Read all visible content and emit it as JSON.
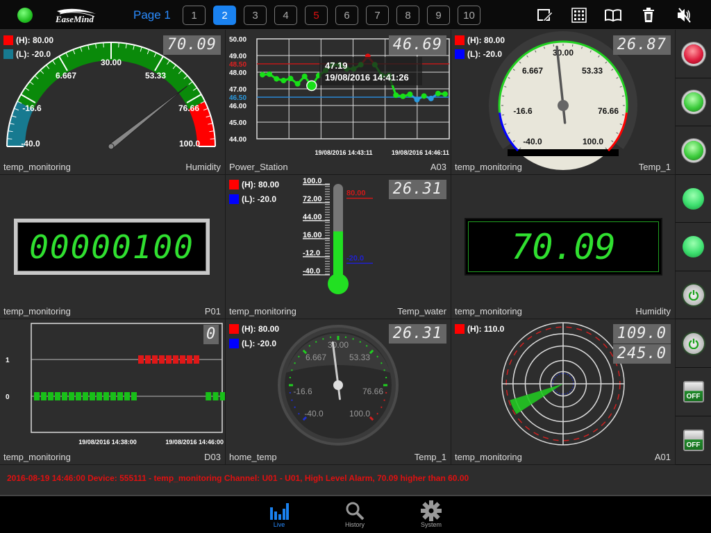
{
  "app": {
    "brand": "EaseMind",
    "connection_status": "online"
  },
  "topbar": {
    "page_label": "Page 1",
    "pages": [
      {
        "label": "1",
        "state": "normal"
      },
      {
        "label": "2",
        "state": "active"
      },
      {
        "label": "3",
        "state": "normal"
      },
      {
        "label": "4",
        "state": "normal"
      },
      {
        "label": "5",
        "state": "alarm"
      },
      {
        "label": "6",
        "state": "normal"
      },
      {
        "label": "7",
        "state": "normal"
      },
      {
        "label": "8",
        "state": "normal"
      },
      {
        "label": "9",
        "state": "normal"
      },
      {
        "label": "10",
        "state": "normal"
      }
    ],
    "tools": [
      "edit-icon",
      "grid-icon",
      "book-icon",
      "trash-icon",
      "mute-icon"
    ]
  },
  "colors": {
    "accent": "#1a82f0",
    "alarm": "#e01010",
    "ok": "#22c022",
    "low": "#1060ff",
    "panel": "#2d2d2d"
  },
  "panels": {
    "gauge_humidity": {
      "device": "temp_monitoring",
      "channel": "Humidity",
      "value": "70.09",
      "high": "(H): 80.00",
      "low": "(L): -20.0",
      "ticks": [
        "-40.0",
        "-16.6",
        "6.667",
        "30.00",
        "53.33",
        "76.66",
        "100.0"
      ],
      "min": -40,
      "max": 100,
      "reading": 70.09,
      "hi_val": 80,
      "lo_val": -20
    },
    "trend_a03": {
      "device": "Power_Station",
      "channel": "A03",
      "value": "46.69",
      "tooltip_value": "47.19",
      "tooltip_time": "19/08/2016 14:41:26"
    },
    "dial_temp1": {
      "device": "temp_monitoring",
      "channel": "Temp_1",
      "value": "26.87",
      "high": "(H): 80.00",
      "low": "(L): -20.0",
      "ticks": [
        "-40.0",
        "-16.6",
        "6.667",
        "30.00",
        "53.33",
        "76.66",
        "100.0"
      ],
      "reading": 26.87
    },
    "counter_p01": {
      "device": "temp_monitoring",
      "channel": "P01",
      "value": "00000100"
    },
    "thermo_water": {
      "device": "temp_monitoring",
      "channel": "Temp_water",
      "value": "26.31",
      "high": "(H): 80.00",
      "low": "(L): -20.0",
      "scale": [
        "100.0",
        "72.00",
        "44.00",
        "16.00",
        "-12.0",
        "-40.0"
      ],
      "hi_mark": "80.00",
      "lo_mark": "-20.0",
      "reading": 26.31
    },
    "display_humidity": {
      "device": "temp_monitoring",
      "channel": "Humidity",
      "value": "70.09"
    },
    "digital_d03": {
      "device": "temp_monitoring",
      "channel": "D03",
      "value": "0",
      "y_labels": [
        "1",
        "0"
      ],
      "x_labels": [
        "19/08/2016 14:38:00",
        "19/08/2016 14:46:00"
      ]
    },
    "dial_home": {
      "device": "home_temp",
      "channel": "Temp_1",
      "value": "26.31",
      "high": "(H): 80.00",
      "low": "(L): -20.0",
      "ticks": [
        "-40.0",
        "-16.6",
        "6.667",
        "30.00",
        "53.33",
        "76.66",
        "100.0"
      ],
      "reading": 26.31
    },
    "radar_a01": {
      "device": "temp_monitoring",
      "channel": "A01",
      "value1": "109.0",
      "value2": "245.0",
      "high": "(H): 110.0",
      "magnitude": 109.0,
      "direction_deg": 245.0
    }
  },
  "chart_data": [
    {
      "type": "line",
      "title": "Power_Station A03",
      "xlabel": "",
      "ylabel": "",
      "y_ticks": [
        "50.00",
        "49.00",
        "48.50",
        "48.00",
        "47.00",
        "46.50",
        "46.00",
        "45.00",
        "44.00"
      ],
      "x_tick_labels": [
        "19/08/2016 14:43:11",
        "19/08/2016 14:46:11"
      ],
      "ylim": [
        44,
        50
      ],
      "high_limit": 48.5,
      "low_limit": 46.5,
      "grid": true,
      "series": [
        {
          "name": "A03",
          "values": [
            47.85,
            47.88,
            47.6,
            47.5,
            47.62,
            47.3,
            47.75,
            47.19,
            47.8,
            48.1,
            48.45,
            48.45,
            48.2,
            48.2,
            48.45,
            48.95,
            48.45,
            47.8,
            47.8,
            46.62,
            46.55,
            46.67,
            46.35,
            46.57,
            46.42,
            46.72,
            46.69
          ]
        }
      ],
      "tooltip": {
        "value": "47.19",
        "time": "19/08/2016 14:41:26"
      }
    },
    {
      "type": "scatter",
      "title": "temp_monitoring D03",
      "y_ticks": [
        "0",
        "1"
      ],
      "x_tick_labels": [
        "19/08/2016 14:38:00",
        "19/08/2016 14:46:00"
      ],
      "ylim": [
        -1,
        2
      ],
      "series": [
        {
          "name": "D03",
          "values": [
            0,
            0,
            0,
            0,
            0,
            0,
            0,
            0,
            0,
            0,
            0,
            0,
            0,
            0,
            0,
            1,
            1,
            1,
            1,
            1,
            1,
            1,
            1,
            1,
            0,
            0,
            0
          ]
        }
      ]
    }
  ],
  "side_indicators": [
    {
      "kind": "led",
      "color": "red"
    },
    {
      "kind": "led",
      "color": "green"
    },
    {
      "kind": "led",
      "color": "green"
    },
    {
      "kind": "soft-led",
      "color": "green"
    },
    {
      "kind": "soft-led",
      "color": "green"
    },
    {
      "kind": "power-button",
      "state": "on"
    },
    {
      "kind": "power-button",
      "state": "on"
    },
    {
      "kind": "switch",
      "label": "OFF"
    },
    {
      "kind": "switch",
      "label": "OFF"
    }
  ],
  "alarm": {
    "message": "2016-08-19 14:46:00 Device: 555111 - temp_monitoring   Channel: U01 - U01, High Level Alarm, 70.09 higher than 60.00"
  },
  "tabbar": {
    "tabs": [
      {
        "label": "Live",
        "active": true
      },
      {
        "label": "History",
        "active": false
      },
      {
        "label": "System",
        "active": false
      }
    ]
  }
}
